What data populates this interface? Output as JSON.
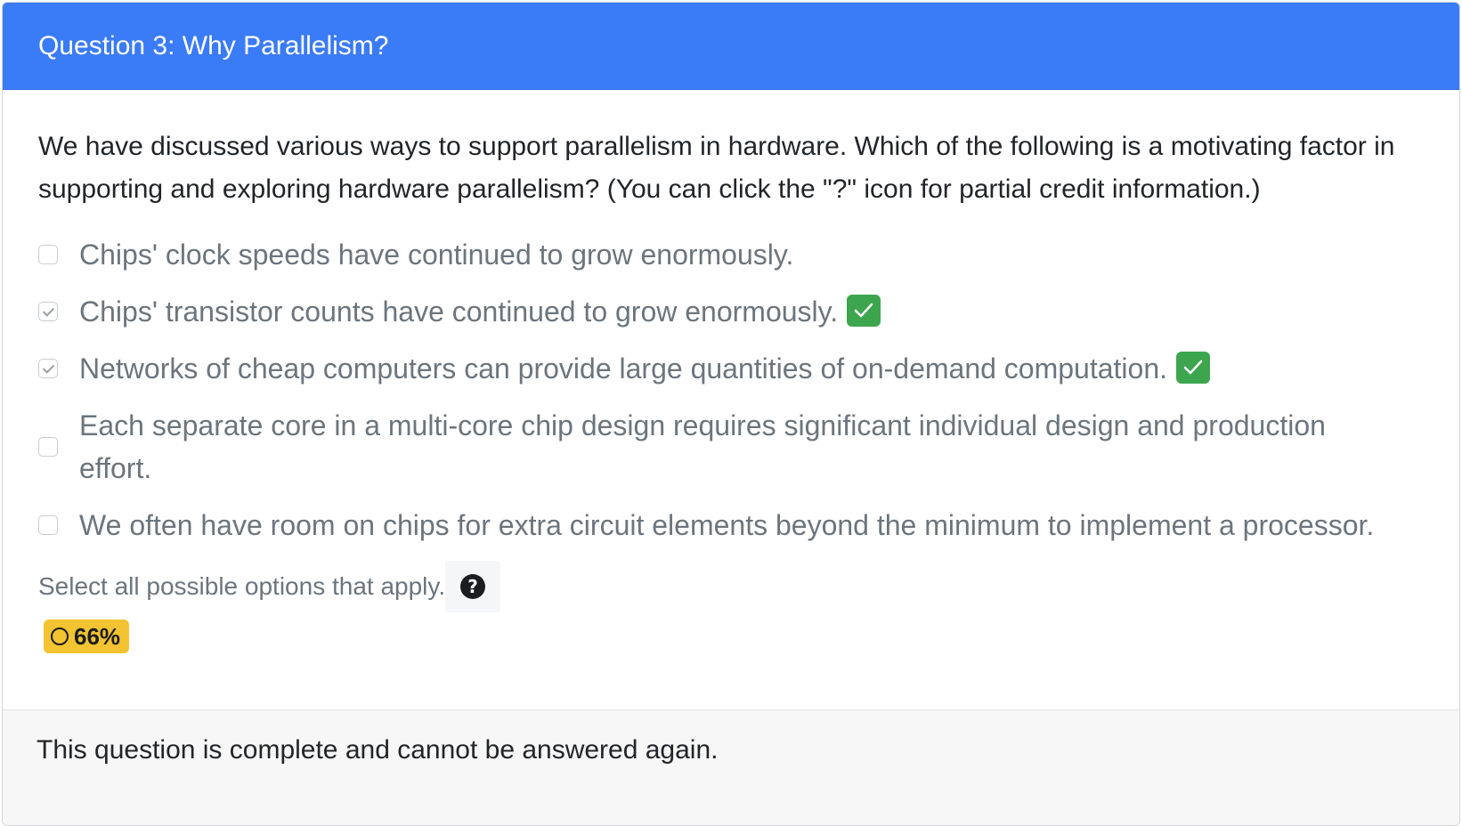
{
  "header": {
    "title": "Question 3: Why Parallelism?"
  },
  "question": {
    "prompt": "We have discussed various ways to support parallelism in hardware. Which of the following is a motivating factor in supporting and exploring hardware parallelism? (You can click the \"?\" icon for partial credit information.)",
    "options": [
      {
        "label": "Chips' clock speeds have continued to grow enormously.",
        "checked": false,
        "marked_correct": false
      },
      {
        "label": "Chips' transistor counts have continued to grow enormously.",
        "checked": true,
        "marked_correct": true
      },
      {
        "label": "Networks of cheap computers can provide large quantities of on-demand computation.",
        "checked": true,
        "marked_correct": true
      },
      {
        "label": "Each separate core in a multi-core chip design requires significant individual design and production effort.",
        "checked": false,
        "marked_correct": false
      },
      {
        "label": "We often have room on chips for extra circuit elements beyond the minimum to implement a processor.",
        "checked": false,
        "marked_correct": false
      }
    ],
    "instruction": "Select all possible options that apply.",
    "help_icon": "?",
    "score": "66%"
  },
  "footer": {
    "message": "This question is complete and cannot be answered again."
  },
  "colors": {
    "header_bg": "#3a7bf7",
    "correct_badge": "#3ea54f",
    "score_badge": "#f3c331"
  }
}
